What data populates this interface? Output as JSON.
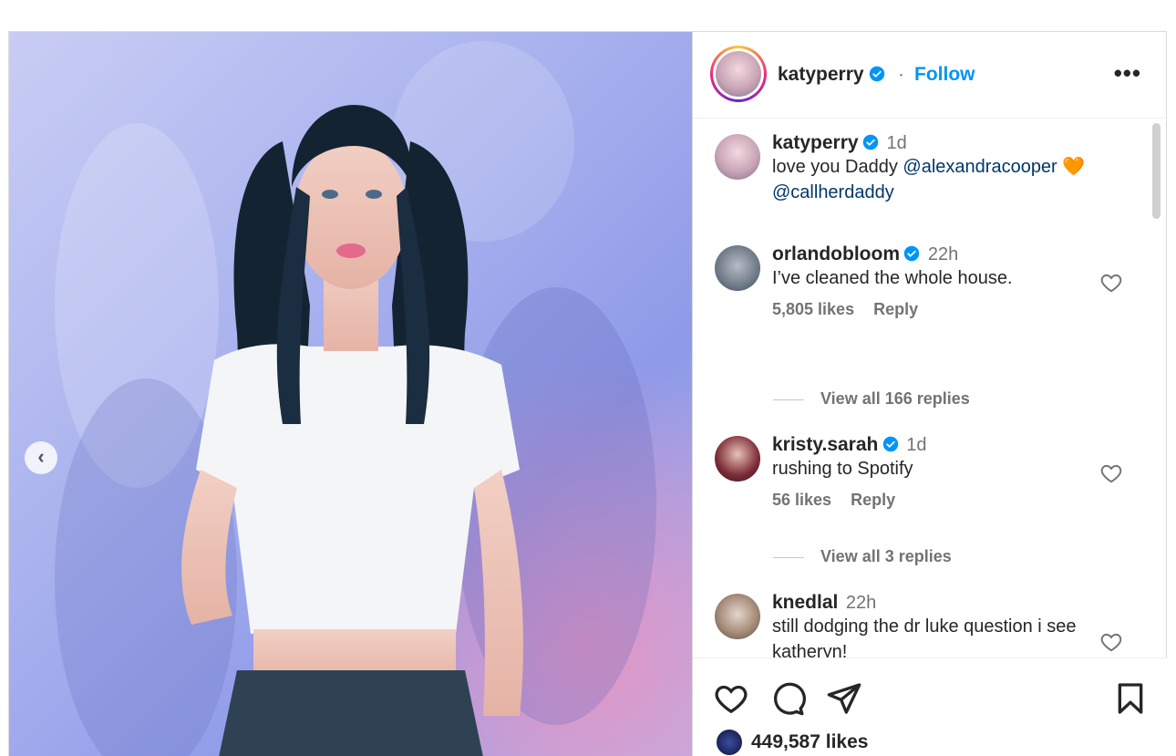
{
  "header": {
    "username": "katyperry",
    "separator": "·",
    "follow_label": "Follow",
    "more_label": "•••"
  },
  "post_caption": {
    "username": "katyperry",
    "time": "1d",
    "text_prefix": "love you Daddy ",
    "mention_1": "@alexandracooper",
    "emoji": "🧡",
    "mention_2": "@callherdaddy"
  },
  "comments": [
    {
      "username": "orlandobloom",
      "verified": true,
      "time": "22h",
      "text": "I’ve cleaned the whole house.",
      "likes": "5,805 likes",
      "reply": "Reply",
      "view_replies": "View all 166 replies"
    },
    {
      "username": "kristy.sarah",
      "verified": true,
      "time": "1d",
      "text": "rushing to Spotify",
      "likes": "56 likes",
      "reply": "Reply",
      "view_replies": "View all 3 replies"
    },
    {
      "username": "knedlal",
      "verified": false,
      "time": "22h",
      "text": "still dodging the dr luke question i see katheryn!"
    }
  ],
  "footer": {
    "likes": "449,587 likes"
  },
  "icons": {
    "verified": "verified-badge-icon",
    "heart": "heart-icon",
    "comment": "comment-icon",
    "share": "share-icon",
    "save": "bookmark-icon",
    "prev": "chevron-left-icon"
  },
  "colors": {
    "link_blue": "#0095f6",
    "mention": "#00376b",
    "verified": "#0095f6",
    "muted": "#737373"
  }
}
